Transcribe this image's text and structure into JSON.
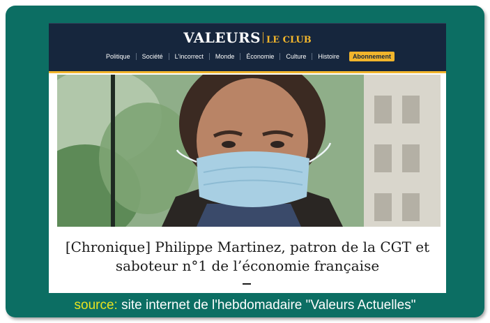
{
  "header": {
    "logo": "VALEURS",
    "club": "LE CLUB",
    "nav": [
      "Politique",
      "Société",
      "L'incorrect",
      "Monde",
      "Économie",
      "Culture",
      "Histoire"
    ],
    "cta": "Abonnement"
  },
  "article": {
    "headline_line1": "[Chronique] Philippe Martinez, patron de la CGT et",
    "headline_line2": "saboteur n°1 de l’économie française"
  },
  "caption": {
    "label": "source:",
    "text": " site internet de l'hebdomadaire \"Valeurs Actuelles\""
  },
  "colors": {
    "frame": "#0c6e63",
    "header_bg": "#16263d",
    "accent": "#f1b52c",
    "caption_label": "#e8e320"
  }
}
